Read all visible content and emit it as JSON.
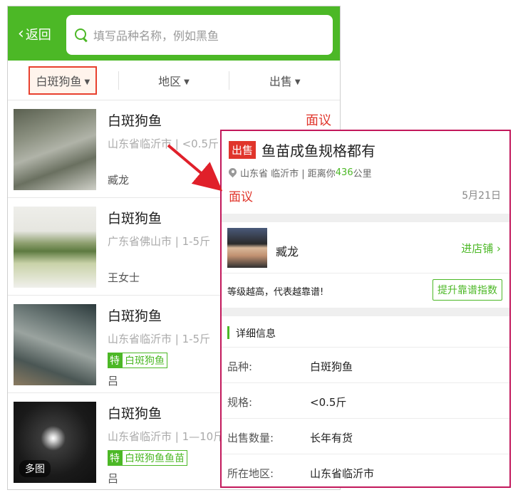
{
  "topbar": {
    "back_label": "返回",
    "search_placeholder": "填写品种名称，例如黑鱼"
  },
  "filters": [
    {
      "label": "白斑狗鱼",
      "selected": true
    },
    {
      "label": "地区",
      "selected": false
    },
    {
      "label": "出售",
      "selected": false
    }
  ],
  "listings": [
    {
      "title": "白斑狗鱼",
      "price": "面议",
      "location": "山东省临沂市 | <0.5斤",
      "seller": "臧龙"
    },
    {
      "title": "白斑狗鱼",
      "price": "",
      "location": "广东省佛山市 | 1-5斤",
      "seller": "王女士"
    },
    {
      "title": "白斑狗鱼",
      "price": "",
      "location": "山东省临沂市 | 1-5斤",
      "tag_mark": "特",
      "tag_name": "白斑狗鱼",
      "seller": "吕"
    },
    {
      "title": "白斑狗鱼",
      "price": "",
      "location": "山东省临沂市 | 1—10斤",
      "tag_mark": "特",
      "tag_name": "白斑狗鱼鱼苗",
      "seller": "吕",
      "multi_label": "多图"
    }
  ],
  "detail": {
    "badge": "出售",
    "title": "鱼苗成鱼规格都有",
    "location_prefix": "山东省 临沂市 | 距离你",
    "distance": "436",
    "distance_unit": "公里",
    "price": "面议",
    "date": "5月21日",
    "shop_name": "臧龙",
    "enter_shop": "进店铺",
    "level_text": "等级越高，代表越靠谱!",
    "level_button": "提升靠谱指数",
    "section_title": "详细信息",
    "rows": [
      {
        "key": "品种:",
        "value": "白斑狗鱼"
      },
      {
        "key": "规格:",
        "value": "<0.5斤"
      },
      {
        "key": "出售数量:",
        "value": "长年有货"
      },
      {
        "key": "所在地区:",
        "value": "山东省临沂市"
      }
    ]
  },
  "colors": {
    "green": "#4cb826",
    "red": "#e0352b",
    "highlight": "#c2185b"
  }
}
